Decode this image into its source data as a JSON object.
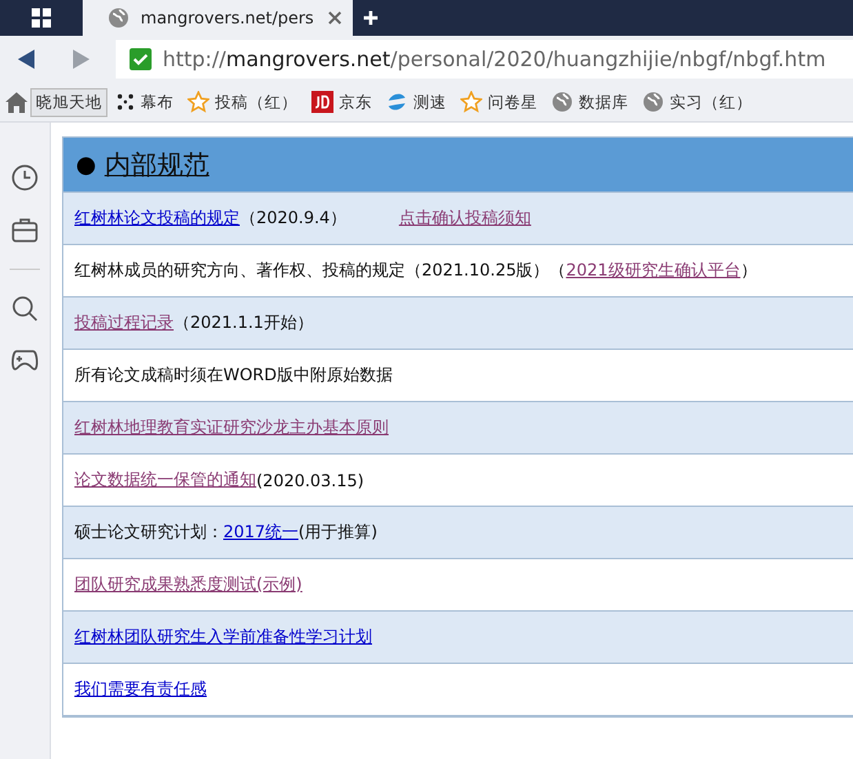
{
  "tab": {
    "title": "mangrovers.net/pers"
  },
  "address": {
    "scheme": "http://",
    "host": "mangrovers.net",
    "path": "/personal/2020/huangzhijie/nbgf/nbgf.htm"
  },
  "bookmarks": [
    {
      "label": "晓旭天地",
      "kind": "none",
      "selected": true
    },
    {
      "label": "幕布",
      "kind": "dots",
      "selected": false
    },
    {
      "label": "投稿（红）",
      "kind": "star",
      "selected": false
    },
    {
      "label": "京东",
      "kind": "jd",
      "selected": false
    },
    {
      "label": "测速",
      "kind": "swirl",
      "selected": false
    },
    {
      "label": "问卷星",
      "kind": "star",
      "selected": false
    },
    {
      "label": "数据库",
      "kind": "globe",
      "selected": false
    },
    {
      "label": "实习（红）",
      "kind": "globe",
      "selected": false
    }
  ],
  "section": {
    "bullet": "●",
    "title": "内部规范"
  },
  "rows": [
    {
      "segments": [
        {
          "kind": "link",
          "text": "红树林论文投稿的规定",
          "visited": false
        },
        {
          "kind": "text",
          "text": "（2020.9.4）"
        },
        {
          "kind": "link",
          "text": "点击确认投稿须知",
          "visited": true,
          "separated": true
        }
      ]
    },
    {
      "segments": [
        {
          "kind": "text",
          "text": "红树林成员的研究方向、著作权、投稿的规定（2021.10.25版）（"
        },
        {
          "kind": "link",
          "text": "2021级研究生确认平台",
          "visited": true
        },
        {
          "kind": "text",
          "text": "）"
        }
      ]
    },
    {
      "segments": [
        {
          "kind": "link",
          "text": "投稿过程记录",
          "visited": true
        },
        {
          "kind": "text",
          "text": "（2021.1.1开始）"
        }
      ]
    },
    {
      "segments": [
        {
          "kind": "text",
          "text": "所有论文成稿时须在WORD版中附原始数据"
        }
      ]
    },
    {
      "segments": [
        {
          "kind": "link",
          "text": "红树林地理教育实证研究沙龙主办基本原则",
          "visited": true
        }
      ]
    },
    {
      "segments": [
        {
          "kind": "link",
          "text": "论文数据统一保管的通知",
          "visited": true
        },
        {
          "kind": "text",
          "text": "(2020.03.15)"
        }
      ]
    },
    {
      "segments": [
        {
          "kind": "text",
          "text": "硕士论文研究计划："
        },
        {
          "kind": "link",
          "text": "2017统一",
          "visited": false
        },
        {
          "kind": "text",
          "text": "(用于推算)"
        }
      ]
    },
    {
      "segments": [
        {
          "kind": "link",
          "text": "团队研究成果熟悉度测试(示例)",
          "visited": true
        }
      ]
    },
    {
      "segments": [
        {
          "kind": "link",
          "text": "红树林团队研究生入学前准备性学习计划",
          "visited": false
        }
      ]
    },
    {
      "segments": [
        {
          "kind": "link",
          "text": "我们需要有责任感",
          "visited": false
        }
      ]
    }
  ]
}
